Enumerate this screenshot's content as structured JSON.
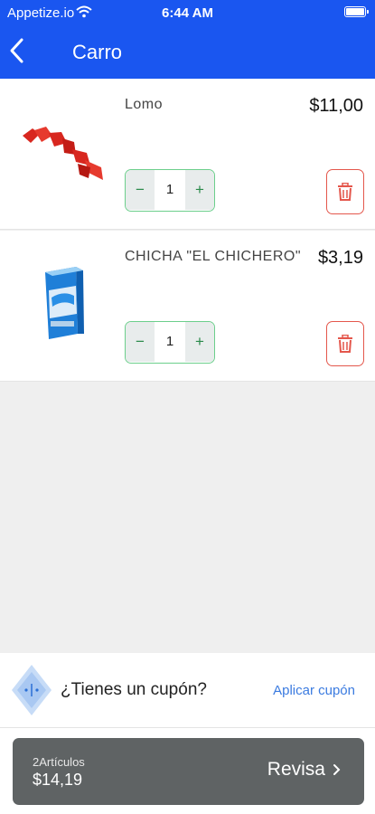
{
  "status_bar": {
    "carrier": "Appetize.io",
    "time": "6:44 AM"
  },
  "header": {
    "title": "Carro"
  },
  "cart": {
    "items": [
      {
        "name": "Lomo",
        "price": "$11,00",
        "quantity": "1"
      },
      {
        "name": "CHICHA \"EL CHICHERO\"",
        "price": "$3,19",
        "quantity": "1"
      }
    ],
    "minus_glyph": "−",
    "plus_glyph": "+"
  },
  "coupon": {
    "prompt": "¿Tienes un cupón?",
    "apply_label": "Aplicar cupón"
  },
  "checkout": {
    "count_label": "2Artículos",
    "total": "$14,19",
    "cta": "Revisa"
  },
  "colors": {
    "header_bg": "#1a56f0",
    "stepper_border": "#6ccf8c",
    "delete_red": "#e4574c",
    "link_blue": "#3b7be0",
    "checkout_bg": "#5f6364"
  },
  "icons": [
    "wifi-icon",
    "battery-icon",
    "back-chevron-icon",
    "trash-icon",
    "coupon-tag-icon",
    "chevron-right-icon"
  ]
}
